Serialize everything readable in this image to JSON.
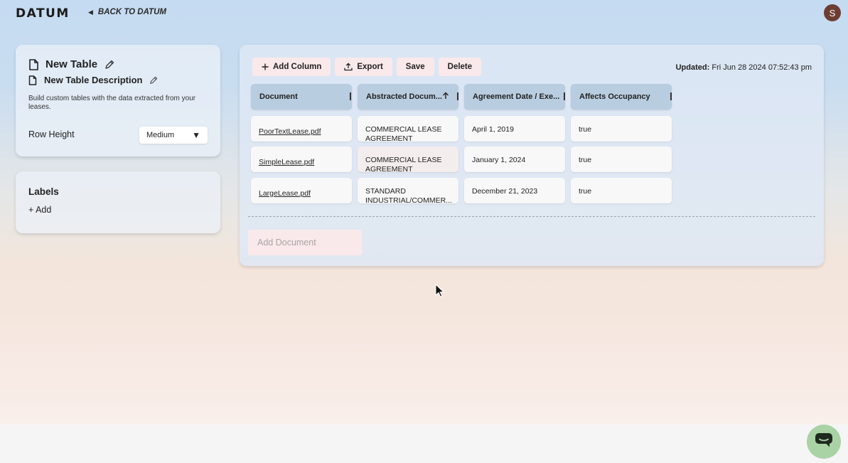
{
  "header": {
    "logo": "DATUM",
    "back_link": "BACK TO DATUM",
    "avatar_initial": "S"
  },
  "meta": {
    "title": "New Table",
    "description": "New Table Description",
    "help_text": "Build custom tables with the data extracted from your leases.",
    "row_height_label": "Row Height",
    "row_height_value": "Medium"
  },
  "labels": {
    "title": "Labels",
    "add": "+ Add"
  },
  "toolbar": {
    "add_column": "Add Column",
    "export": "Export",
    "save": "Save",
    "delete": "Delete",
    "updated_label": "Updated:",
    "updated_value": "Fri Jun 28 2024 07:52:43 pm"
  },
  "table": {
    "columns": [
      {
        "label": "Document"
      },
      {
        "label": "Abstracted Docum..."
      },
      {
        "label": "Agreement Date / Exe..."
      },
      {
        "label": "Affects Occupancy"
      }
    ],
    "rows": [
      {
        "document": "PoorTextLease.pdf",
        "abstracted": "COMMERCIAL LEASE AGREEMENT",
        "date": "April 1, 2019",
        "occupancy": "true"
      },
      {
        "document": "SimpleLease.pdf",
        "abstracted": "COMMERCIAL LEASE AGREEMENT",
        "date": "January 1, 2024",
        "occupancy": "true"
      },
      {
        "document": "LargeLease.pdf",
        "abstracted": "STANDARD INDUSTRIAL/COMMER...",
        "date": "December 21, 2023",
        "occupancy": "true"
      }
    ]
  },
  "add_document_placeholder": "Add Document",
  "icons": {
    "document": "document-icon",
    "edit": "pencil-icon",
    "add": "plus-icon",
    "export": "upload-icon",
    "sort": "arrow-up-icon",
    "chat": "chat-bubble-icon",
    "back": "back-triangle-icon"
  },
  "colors": {
    "button_bg": "#fae9ea",
    "header_cell_bg": "#b9cde0",
    "avatar_bg": "#6d3d33",
    "chat_bg": "#a9d2a5"
  }
}
